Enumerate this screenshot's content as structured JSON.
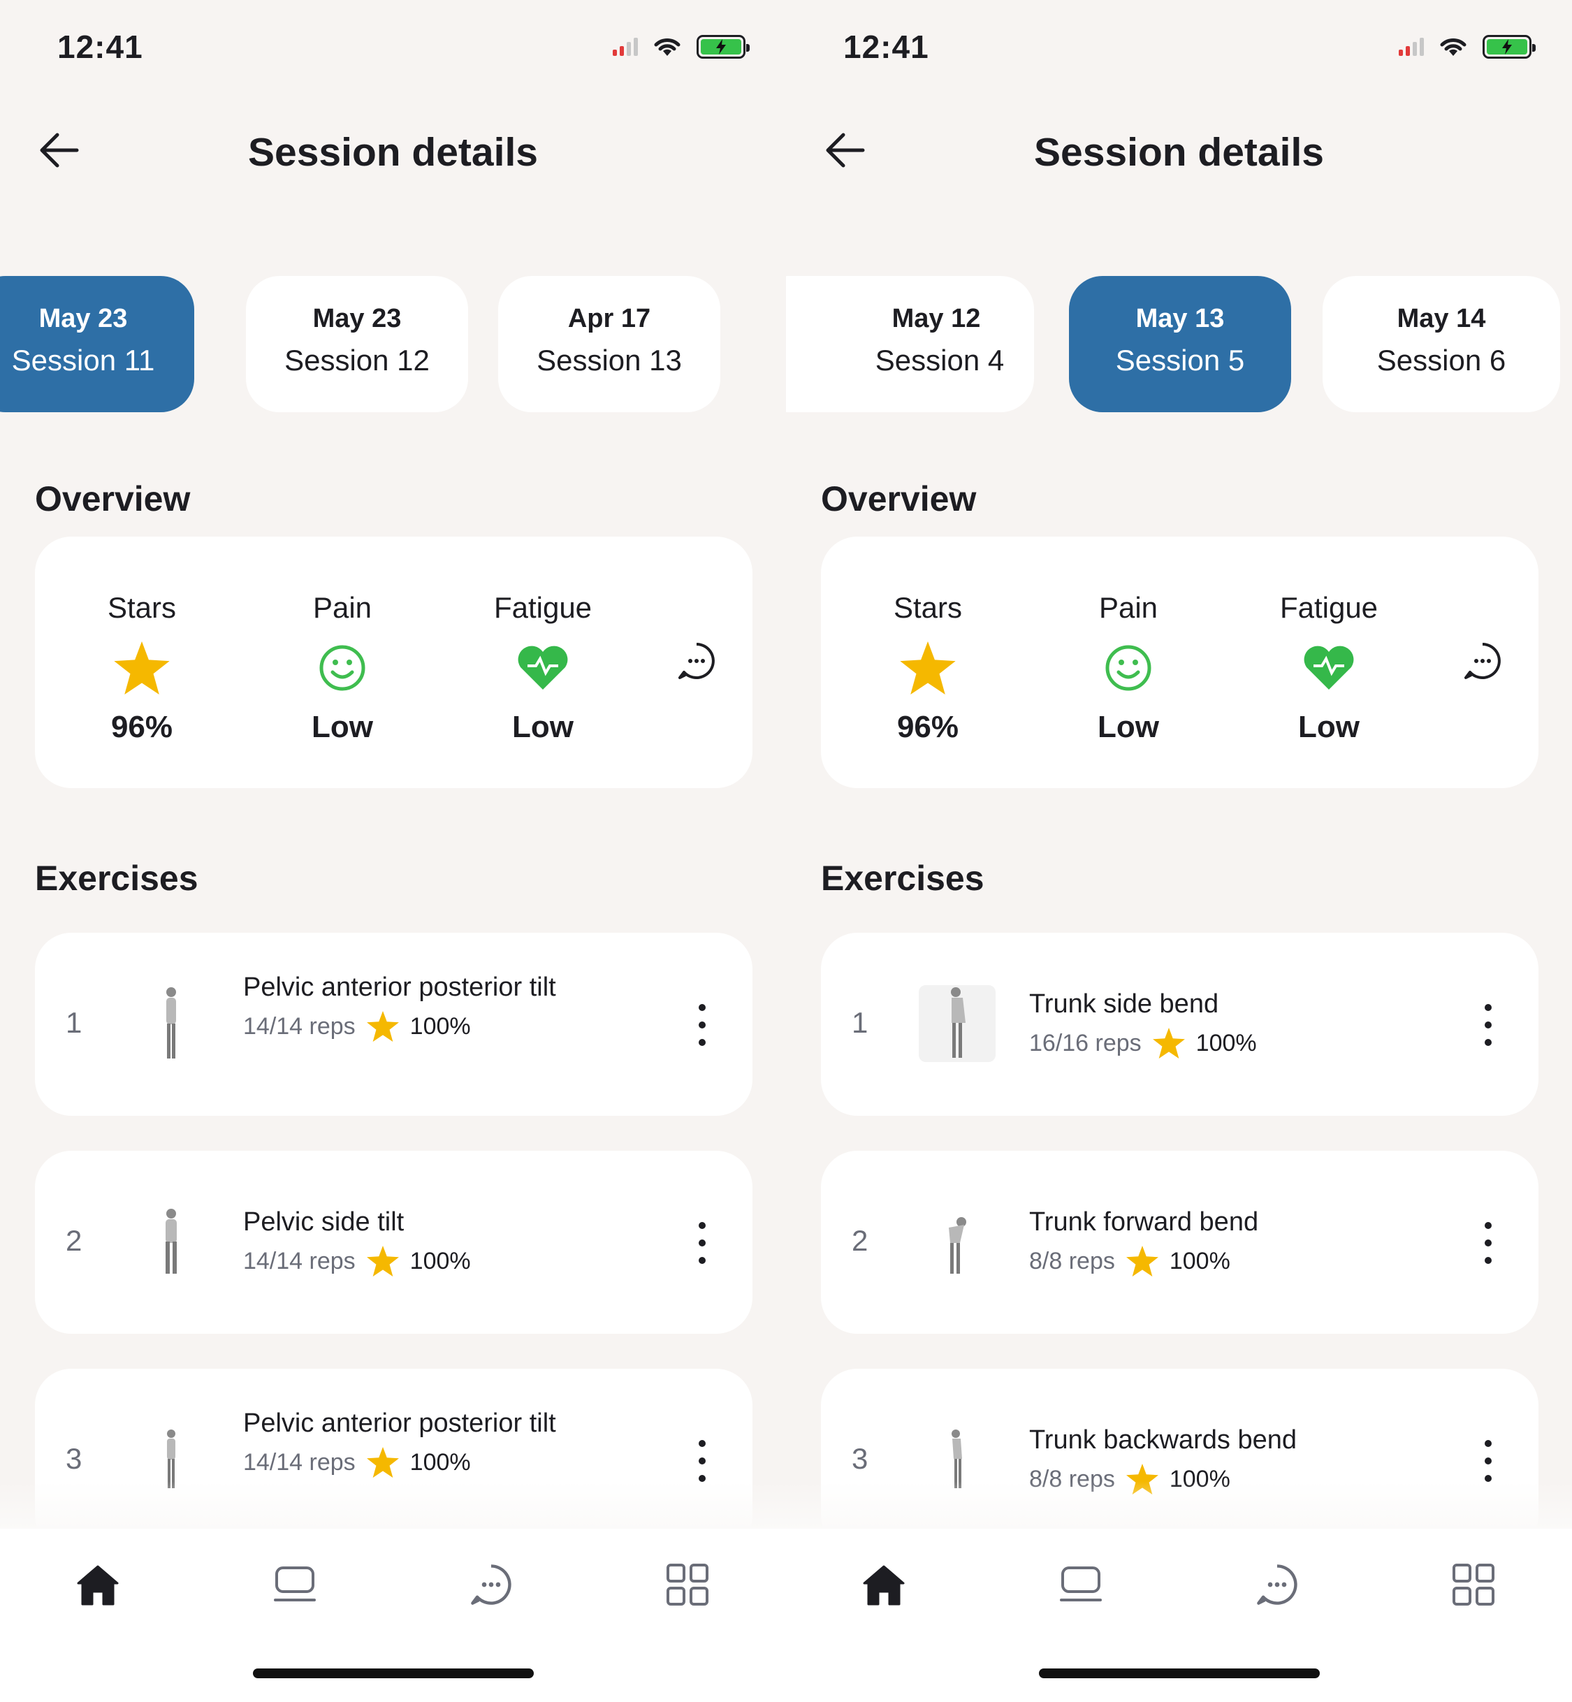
{
  "colors": {
    "accent": "#2e6fa6",
    "star": "#f5b800",
    "pain_green": "#3fbd4f",
    "heart_green": "#35b84a",
    "background": "#f7f4f2"
  },
  "screens": [
    {
      "status": {
        "time": "12:41"
      },
      "header": {
        "title": "Session details"
      },
      "sessions": [
        {
          "date": "May 23",
          "name": "Session 11",
          "active": true
        },
        {
          "date": "May 23",
          "name": "Session 12",
          "active": false
        },
        {
          "date": "Apr 17",
          "name": "Session 13",
          "active": false
        }
      ],
      "overview": {
        "title": "Overview",
        "stars": {
          "label": "Stars",
          "value": "96%",
          "icon": "star-icon"
        },
        "pain": {
          "label": "Pain",
          "value": "Low",
          "icon": "smiley-icon"
        },
        "fatigue": {
          "label": "Fatigue",
          "value": "Low",
          "icon": "heart-icon"
        }
      },
      "exercises_title": "Exercises",
      "exercises": [
        {
          "num": "1",
          "name": "Pelvic anterior posterior tilt",
          "reps": "14/14 reps",
          "percent": "100%"
        },
        {
          "num": "2",
          "name": "Pelvic side tilt",
          "reps": "14/14 reps",
          "percent": "100%"
        },
        {
          "num": "3",
          "name": "Pelvic anterior posterior tilt",
          "reps": "14/14 reps",
          "percent": "100%"
        }
      ],
      "nav": [
        "home-icon",
        "tablet-icon",
        "chat-icon",
        "grid-icon"
      ]
    },
    {
      "status": {
        "time": "12:41"
      },
      "header": {
        "title": "Session details"
      },
      "sessions": [
        {
          "date": "May 12",
          "name": "Session 4",
          "active": false
        },
        {
          "date": "May 13",
          "name": "Session 5",
          "active": true
        },
        {
          "date": "May 14",
          "name": "Session 6",
          "active": false
        }
      ],
      "overview": {
        "title": "Overview",
        "stars": {
          "label": "Stars",
          "value": "96%",
          "icon": "star-icon"
        },
        "pain": {
          "label": "Pain",
          "value": "Low",
          "icon": "smiley-icon"
        },
        "fatigue": {
          "label": "Fatigue",
          "value": "Low",
          "icon": "heart-icon"
        }
      },
      "exercises_title": "Exercises",
      "exercises": [
        {
          "num": "1",
          "name": "Trunk side bend",
          "reps": "16/16 reps",
          "percent": "100%"
        },
        {
          "num": "2",
          "name": "Trunk forward bend",
          "reps": "8/8 reps",
          "percent": "100%"
        },
        {
          "num": "3",
          "name": "Trunk backwards bend",
          "reps": "8/8 reps",
          "percent": "100%"
        }
      ],
      "nav": [
        "home-icon",
        "tablet-icon",
        "chat-icon",
        "grid-icon"
      ]
    }
  ]
}
